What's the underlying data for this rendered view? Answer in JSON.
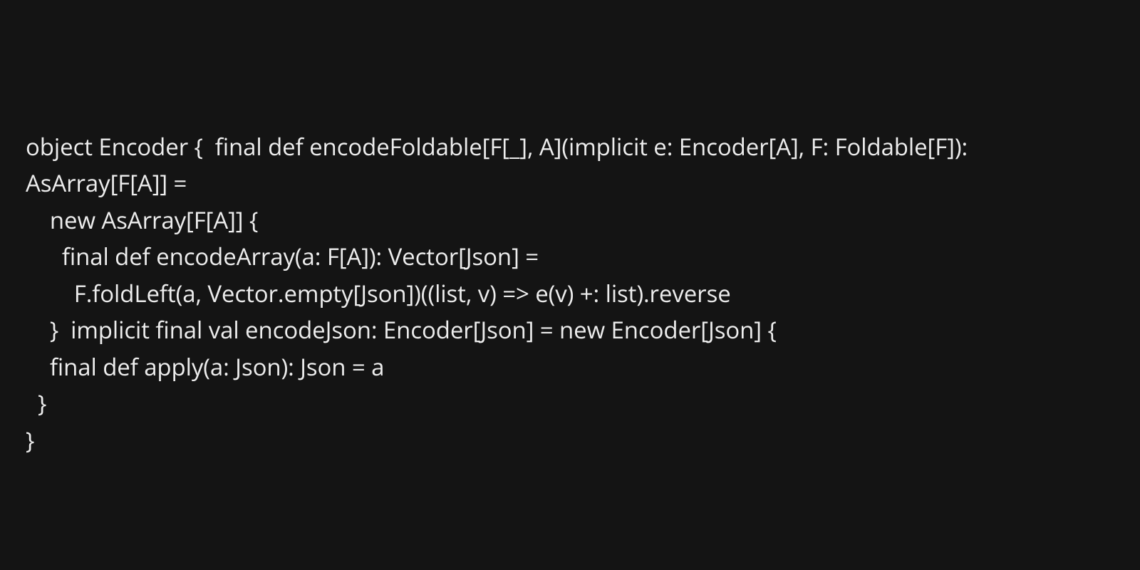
{
  "code": "object Encoder {  final def encodeFoldable[F[_], A](implicit e: Encoder[A], F: Foldable[F]): AsArray[F[A]] =\n    new AsArray[F[A]] {\n      final def encodeArray(a: F[A]): Vector[Json] =\n        F.foldLeft(a, Vector.empty[Json])((list, v) => e(v) +: list).reverse\n    }  implicit final val encodeJson: Encoder[Json] = new Encoder[Json] {\n    final def apply(a: Json): Json = a\n  }\n}"
}
